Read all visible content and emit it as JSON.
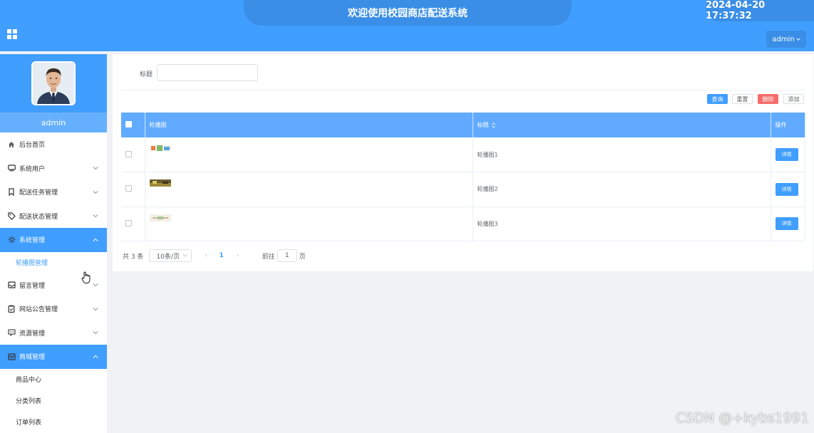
{
  "header": {
    "title": "欢迎使用校园商店配送系统",
    "datetime": "2024-04-20 17:37:32",
    "user_menu": "admin"
  },
  "sidebar": {
    "username": "admin",
    "items": [
      {
        "label": "后台首页",
        "icon": "home-icon"
      },
      {
        "label": "系统用户",
        "icon": "monitor-icon"
      },
      {
        "label": "配送任务管理",
        "icon": "bookmark-icon"
      },
      {
        "label": "配送状态管理",
        "icon": "tag-icon"
      },
      {
        "label": "系统管理",
        "icon": "sun-icon",
        "expanded": true
      },
      {
        "label": "留言管理",
        "icon": "inbox-icon"
      },
      {
        "label": "网站公告管理",
        "icon": "clipboard-icon"
      },
      {
        "label": "资源管理",
        "icon": "chat-icon"
      },
      {
        "label": "商城管理",
        "icon": "store-icon",
        "expanded": true
      }
    ],
    "system_sub": [
      {
        "label": "轮播图管理",
        "active": true
      }
    ],
    "mall_sub": [
      {
        "label": "商品中心"
      },
      {
        "label": "分类列表"
      },
      {
        "label": "订单列表"
      }
    ]
  },
  "search": {
    "label": "标题",
    "value": ""
  },
  "toolbar": {
    "query": "查询",
    "reset": "重置",
    "delete": "删除",
    "add": "添加"
  },
  "table": {
    "headers": {
      "image": "轮播图",
      "title": "标题",
      "actions": "操作"
    },
    "rows": [
      {
        "title": "轮播图1",
        "action": "详情"
      },
      {
        "title": "轮播图2",
        "action": "详情"
      },
      {
        "title": "轮播图3",
        "action": "详情"
      }
    ]
  },
  "pagination": {
    "total": "共 3 条",
    "page_size": "10条/页",
    "current_page": "1",
    "goto_label": "前往",
    "goto_value": "1",
    "page_unit": "页"
  },
  "watermark": "CSDN @+kybs1991",
  "colors": {
    "primary": "#409eff",
    "danger": "#f56c6c",
    "header_pill": "#3a8ee6"
  }
}
